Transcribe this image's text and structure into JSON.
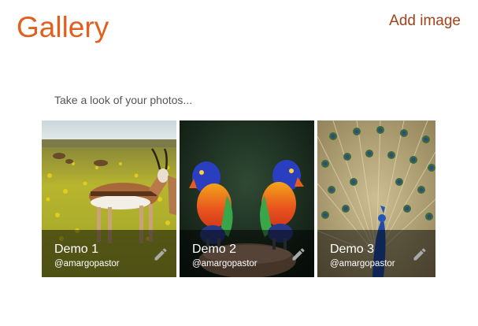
{
  "header": {
    "title": "Gallery",
    "add_link": "Add image"
  },
  "main": {
    "subtitle": "Take a look of your photos..."
  },
  "gallery": {
    "items": [
      {
        "title": "Demo 1",
        "user": "@amargopastor"
      },
      {
        "title": "Demo 2",
        "user": "@amargopastor"
      },
      {
        "title": "Demo 3",
        "user": "@amargopastor"
      }
    ]
  },
  "icons": {
    "edit": "pencil-icon"
  },
  "colors": {
    "title": "#e2601f",
    "link": "#a0431b",
    "subtitle": "#555555"
  }
}
